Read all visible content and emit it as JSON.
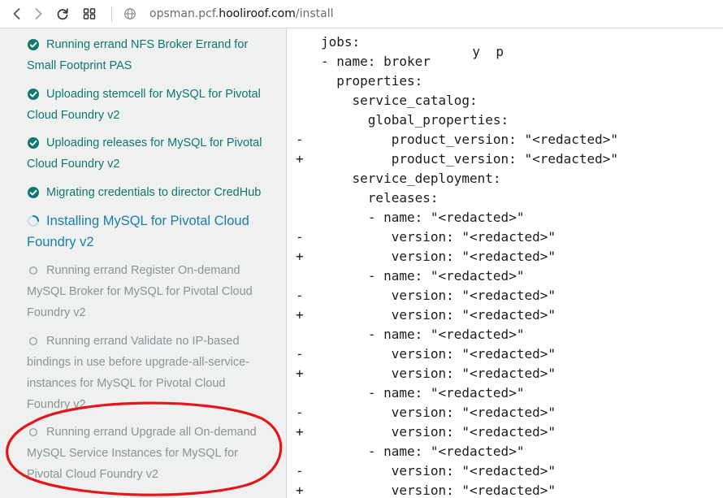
{
  "browser": {
    "url_prefix": "opsman.pcf.",
    "url_host": "hooliroof.com",
    "url_path": "/install",
    "icons": [
      "back-icon",
      "forward-icon",
      "reload-icon",
      "tabs-grid-icon",
      "globe-icon"
    ]
  },
  "sidebar": {
    "steps": [
      {
        "status": "done",
        "label": "Running errand NFS Broker Errand for Small Footprint PAS"
      },
      {
        "status": "done",
        "label": "Uploading stemcell for MySQL for Pivotal Cloud Foundry v2"
      },
      {
        "status": "done",
        "label": "Uploading releases for MySQL for Pivotal Cloud Foundry v2"
      },
      {
        "status": "done",
        "label": "Migrating credentials to director CredHub"
      },
      {
        "status": "active",
        "label": "Installing MySQL for Pivotal Cloud Foundry v2"
      },
      {
        "status": "pending",
        "label": "Running errand Register On-demand MySQL Broker for MySQL for Pivotal Cloud Foundry v2"
      },
      {
        "status": "pending",
        "label": "Running errand Validate no IP-based bindings in use before upgrade-all-service-instances for MySQL for Pivotal Cloud Foundry v2"
      },
      {
        "status": "pending",
        "label": "Running errand Upgrade all On-demand MySQL Service Instances for MySQL for Pivotal Cloud Foundry v2"
      }
    ]
  },
  "colors": {
    "done": "#10786e",
    "active": "#1b7eaa",
    "pending": "#8d9396",
    "annotation": "#e8141b"
  },
  "code": {
    "lines": [
      {
        "m": "",
        "t": "jobs:"
      },
      {
        "m": "",
        "t": "- name: broker"
      },
      {
        "m": "",
        "t": "  properties:"
      },
      {
        "m": "",
        "t": "    service_catalog:"
      },
      {
        "m": "",
        "t": "      global_properties:"
      },
      {
        "m": "-",
        "t": "         product_version: \"<redacted>\""
      },
      {
        "m": "+",
        "t": "         product_version: \"<redacted>\""
      },
      {
        "m": "",
        "t": "    service_deployment:"
      },
      {
        "m": "",
        "t": "      releases:"
      },
      {
        "m": "",
        "t": "      - name: \"<redacted>\""
      },
      {
        "m": "-",
        "t": "         version: \"<redacted>\""
      },
      {
        "m": "+",
        "t": "         version: \"<redacted>\""
      },
      {
        "m": "",
        "t": "      - name: \"<redacted>\""
      },
      {
        "m": "-",
        "t": "         version: \"<redacted>\""
      },
      {
        "m": "+",
        "t": "         version: \"<redacted>\""
      },
      {
        "m": "",
        "t": "      - name: \"<redacted>\""
      },
      {
        "m": "-",
        "t": "         version: \"<redacted>\""
      },
      {
        "m": "+",
        "t": "         version: \"<redacted>\""
      },
      {
        "m": "",
        "t": "      - name: \"<redacted>\""
      },
      {
        "m": "-",
        "t": "         version: \"<redacted>\""
      },
      {
        "m": "+",
        "t": "         version: \"<redacted>\""
      },
      {
        "m": "",
        "t": "      - name: \"<redacted>\""
      },
      {
        "m": "-",
        "t": "         version: \"<redacted>\""
      },
      {
        "m": "+",
        "t": "         version: \"<redacted>\""
      }
    ]
  }
}
